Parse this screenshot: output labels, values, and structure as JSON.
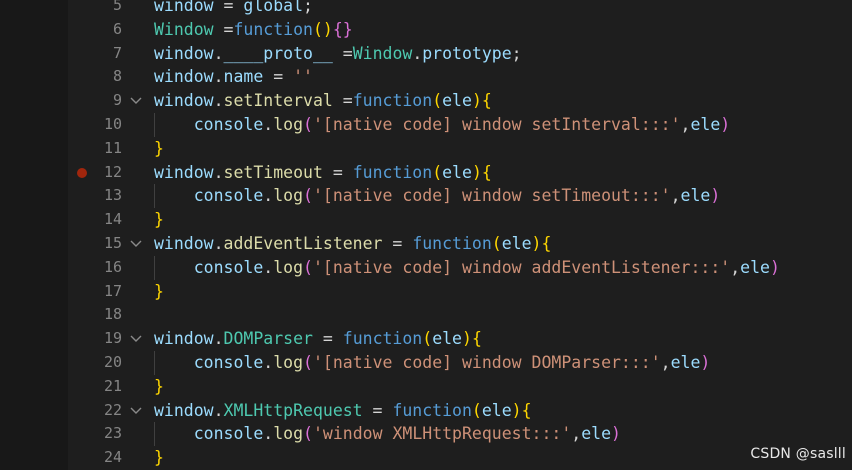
{
  "editor": {
    "lines": [
      {
        "num": "5",
        "fold": false,
        "breakpoint": false,
        "indent": false,
        "tokens": [
          {
            "t": "window",
            "c": "c-plain"
          },
          {
            "t": " = ",
            "c": "c-white"
          },
          {
            "t": "global",
            "c": "c-plain"
          },
          {
            "t": ";",
            "c": "c-white"
          }
        ]
      },
      {
        "num": "6",
        "fold": false,
        "breakpoint": false,
        "indent": false,
        "tokens": [
          {
            "t": "Window",
            "c": "c-type"
          },
          {
            "t": " =",
            "c": "c-white"
          },
          {
            "t": "function",
            "c": "c-kw"
          },
          {
            "t": "()",
            "c": "c-br1"
          },
          {
            "t": "{}",
            "c": "c-br2"
          }
        ]
      },
      {
        "num": "7",
        "fold": false,
        "breakpoint": false,
        "indent": false,
        "tokens": [
          {
            "t": "window",
            "c": "c-plain"
          },
          {
            "t": ".",
            "c": "c-white"
          },
          {
            "t": "____proto__",
            "c": "c-plain"
          },
          {
            "t": " =",
            "c": "c-white"
          },
          {
            "t": "Window",
            "c": "c-type"
          },
          {
            "t": ".",
            "c": "c-white"
          },
          {
            "t": "prototype",
            "c": "c-plain"
          },
          {
            "t": ";",
            "c": "c-white"
          }
        ]
      },
      {
        "num": "8",
        "fold": false,
        "breakpoint": false,
        "indent": false,
        "tokens": [
          {
            "t": "window",
            "c": "c-plain"
          },
          {
            "t": ".",
            "c": "c-white"
          },
          {
            "t": "name",
            "c": "c-plain"
          },
          {
            "t": " = ",
            "c": "c-white"
          },
          {
            "t": "''",
            "c": "c-str"
          }
        ]
      },
      {
        "num": "9",
        "fold": true,
        "breakpoint": false,
        "indent": false,
        "tokens": [
          {
            "t": "window",
            "c": "c-plain"
          },
          {
            "t": ".",
            "c": "c-white"
          },
          {
            "t": "setInterval",
            "c": "c-fn"
          },
          {
            "t": " =",
            "c": "c-white"
          },
          {
            "t": "function",
            "c": "c-kw"
          },
          {
            "t": "(",
            "c": "c-br1"
          },
          {
            "t": "ele",
            "c": "c-plain"
          },
          {
            "t": ")",
            "c": "c-br1"
          },
          {
            "t": "{",
            "c": "c-br1"
          }
        ]
      },
      {
        "num": "10",
        "fold": false,
        "breakpoint": false,
        "indent": true,
        "tokens": [
          {
            "t": "    ",
            "c": "c-white"
          },
          {
            "t": "console",
            "c": "c-plain"
          },
          {
            "t": ".",
            "c": "c-white"
          },
          {
            "t": "log",
            "c": "c-fn"
          },
          {
            "t": "(",
            "c": "c-br2"
          },
          {
            "t": "'[native code] window setInterval:::'",
            "c": "c-str"
          },
          {
            "t": ",",
            "c": "c-white"
          },
          {
            "t": "ele",
            "c": "c-plain"
          },
          {
            "t": ")",
            "c": "c-br2"
          }
        ]
      },
      {
        "num": "11",
        "fold": false,
        "breakpoint": false,
        "indent": false,
        "tokens": [
          {
            "t": "}",
            "c": "c-br1"
          }
        ]
      },
      {
        "num": "12",
        "fold": false,
        "breakpoint": true,
        "indent": false,
        "tokens": [
          {
            "t": "window",
            "c": "c-plain"
          },
          {
            "t": ".",
            "c": "c-white"
          },
          {
            "t": "setTimeout",
            "c": "c-fn"
          },
          {
            "t": " = ",
            "c": "c-white"
          },
          {
            "t": "function",
            "c": "c-kw"
          },
          {
            "t": "(",
            "c": "c-br1"
          },
          {
            "t": "ele",
            "c": "c-plain"
          },
          {
            "t": ")",
            "c": "c-br1"
          },
          {
            "t": "{",
            "c": "c-br1"
          }
        ]
      },
      {
        "num": "13",
        "fold": false,
        "breakpoint": false,
        "indent": true,
        "tokens": [
          {
            "t": "    ",
            "c": "c-white"
          },
          {
            "t": "console",
            "c": "c-plain"
          },
          {
            "t": ".",
            "c": "c-white"
          },
          {
            "t": "log",
            "c": "c-fn"
          },
          {
            "t": "(",
            "c": "c-br2"
          },
          {
            "t": "'[native code] window setTimeout:::'",
            "c": "c-str"
          },
          {
            "t": ",",
            "c": "c-white"
          },
          {
            "t": "ele",
            "c": "c-plain"
          },
          {
            "t": ")",
            "c": "c-br2"
          }
        ]
      },
      {
        "num": "14",
        "fold": false,
        "breakpoint": false,
        "indent": false,
        "tokens": [
          {
            "t": "}",
            "c": "c-br1"
          }
        ]
      },
      {
        "num": "15",
        "fold": true,
        "breakpoint": false,
        "indent": false,
        "tokens": [
          {
            "t": "window",
            "c": "c-plain"
          },
          {
            "t": ".",
            "c": "c-white"
          },
          {
            "t": "addEventListener",
            "c": "c-fn"
          },
          {
            "t": " = ",
            "c": "c-white"
          },
          {
            "t": "function",
            "c": "c-kw"
          },
          {
            "t": "(",
            "c": "c-br1"
          },
          {
            "t": "ele",
            "c": "c-plain"
          },
          {
            "t": ")",
            "c": "c-br1"
          },
          {
            "t": "{",
            "c": "c-br1"
          }
        ]
      },
      {
        "num": "16",
        "fold": false,
        "breakpoint": false,
        "indent": true,
        "tokens": [
          {
            "t": "    ",
            "c": "c-white"
          },
          {
            "t": "console",
            "c": "c-plain"
          },
          {
            "t": ".",
            "c": "c-white"
          },
          {
            "t": "log",
            "c": "c-fn"
          },
          {
            "t": "(",
            "c": "c-br2"
          },
          {
            "t": "'[native code] window addEventListener:::'",
            "c": "c-str"
          },
          {
            "t": ",",
            "c": "c-white"
          },
          {
            "t": "ele",
            "c": "c-plain"
          },
          {
            "t": ")",
            "c": "c-br2"
          }
        ]
      },
      {
        "num": "17",
        "fold": false,
        "breakpoint": false,
        "indent": false,
        "tokens": [
          {
            "t": "}",
            "c": "c-br1"
          }
        ]
      },
      {
        "num": "18",
        "fold": false,
        "breakpoint": false,
        "indent": false,
        "tokens": []
      },
      {
        "num": "19",
        "fold": true,
        "breakpoint": false,
        "indent": false,
        "tokens": [
          {
            "t": "window",
            "c": "c-plain"
          },
          {
            "t": ".",
            "c": "c-white"
          },
          {
            "t": "DOMParser",
            "c": "c-type"
          },
          {
            "t": " = ",
            "c": "c-white"
          },
          {
            "t": "function",
            "c": "c-kw"
          },
          {
            "t": "(",
            "c": "c-br1"
          },
          {
            "t": "ele",
            "c": "c-plain"
          },
          {
            "t": ")",
            "c": "c-br1"
          },
          {
            "t": "{",
            "c": "c-br1"
          }
        ]
      },
      {
        "num": "20",
        "fold": false,
        "breakpoint": false,
        "indent": true,
        "tokens": [
          {
            "t": "    ",
            "c": "c-white"
          },
          {
            "t": "console",
            "c": "c-plain"
          },
          {
            "t": ".",
            "c": "c-white"
          },
          {
            "t": "log",
            "c": "c-fn"
          },
          {
            "t": "(",
            "c": "c-br2"
          },
          {
            "t": "'[native code] window DOMParser:::'",
            "c": "c-str"
          },
          {
            "t": ",",
            "c": "c-white"
          },
          {
            "t": "ele",
            "c": "c-plain"
          },
          {
            "t": ")",
            "c": "c-br2"
          }
        ]
      },
      {
        "num": "21",
        "fold": false,
        "breakpoint": false,
        "indent": false,
        "tokens": [
          {
            "t": "}",
            "c": "c-br1"
          }
        ]
      },
      {
        "num": "22",
        "fold": true,
        "breakpoint": false,
        "indent": false,
        "tokens": [
          {
            "t": "window",
            "c": "c-plain"
          },
          {
            "t": ".",
            "c": "c-white"
          },
          {
            "t": "XMLHttpRequest",
            "c": "c-type"
          },
          {
            "t": " = ",
            "c": "c-white"
          },
          {
            "t": "function",
            "c": "c-kw"
          },
          {
            "t": "(",
            "c": "c-br1"
          },
          {
            "t": "ele",
            "c": "c-plain"
          },
          {
            "t": ")",
            "c": "c-br1"
          },
          {
            "t": "{",
            "c": "c-br1"
          }
        ]
      },
      {
        "num": "23",
        "fold": false,
        "breakpoint": false,
        "indent": true,
        "tokens": [
          {
            "t": "    ",
            "c": "c-white"
          },
          {
            "t": "console",
            "c": "c-plain"
          },
          {
            "t": ".",
            "c": "c-white"
          },
          {
            "t": "log",
            "c": "c-fn"
          },
          {
            "t": "(",
            "c": "c-br2"
          },
          {
            "t": "'window XMLHttpRequest:::'",
            "c": "c-str"
          },
          {
            "t": ",",
            "c": "c-white"
          },
          {
            "t": "ele",
            "c": "c-plain"
          },
          {
            "t": ")",
            "c": "c-br2"
          }
        ]
      },
      {
        "num": "24",
        "fold": false,
        "breakpoint": false,
        "indent": false,
        "tokens": [
          {
            "t": "}",
            "c": "c-br1"
          }
        ]
      }
    ]
  },
  "watermark": {
    "text": "CSDN @saslll"
  },
  "colors": {
    "background": "#1e1e1e",
    "sidebar": "#181818",
    "breakpoint": "#a1260d"
  }
}
